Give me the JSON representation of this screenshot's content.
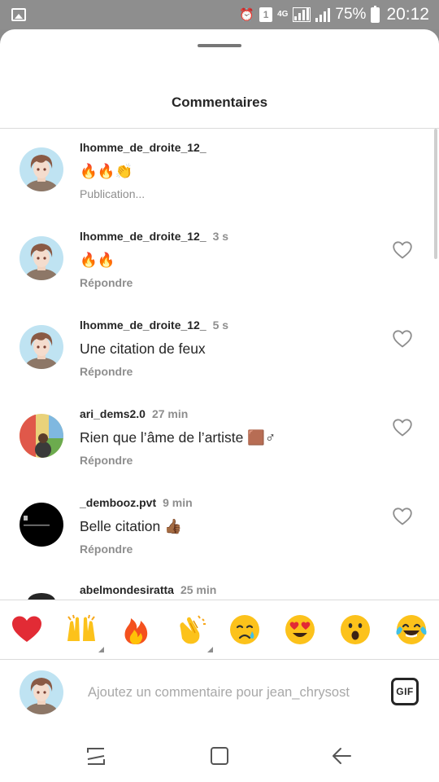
{
  "status_bar": {
    "left_icon": "gallery-icon",
    "network": "4G",
    "battery_percent": "75%",
    "time": "20:12",
    "sim_slot": "1",
    "icons": [
      "alarm-icon",
      "sim-icon",
      "4g-icon",
      "signal-icon",
      "battery-icon"
    ]
  },
  "sheet": {
    "title": "Commentaires"
  },
  "comments": [
    {
      "username": "lhomme_de_droite_12_",
      "time": "",
      "text": "🔥🔥👏",
      "action": "Publication...",
      "liked": false,
      "avatar": "anime-boy"
    },
    {
      "username": "lhomme_de_droite_12_",
      "time": "3 s",
      "text": "🔥🔥",
      "action": "Répondre",
      "liked": false,
      "avatar": "anime-boy"
    },
    {
      "username": "lhomme_de_droite_12_",
      "time": "5 s",
      "text": "Une citation de feux",
      "action": "Répondre",
      "liked": false,
      "avatar": "anime-boy"
    },
    {
      "username": "ari_dems2.0",
      "time": "27 min",
      "text": "Rien que l’âme de l’artiste 🟫♂",
      "action": "Répondre",
      "liked": false,
      "avatar": "street-art"
    },
    {
      "username": "_dembooz.pvt",
      "time": "9 min",
      "text": "Belle citation 👍🏾",
      "action": "Répondre",
      "liked": false,
      "avatar": "dark-circle"
    },
    {
      "username": "abelmondesiratta",
      "time": "25 min"
    }
  ],
  "emoji_bar": {
    "emojis": [
      "❤️",
      "🙌",
      "🔥",
      "👏",
      "😢",
      "😍",
      "😮",
      "😂"
    ],
    "icons": [
      "red-heart-icon",
      "raising-hands-icon",
      "fire-icon",
      "clapping-hands-icon",
      "crying-face-icon",
      "heart-eyes-icon",
      "surprised-face-icon",
      "tears-of-joy-icon"
    ]
  },
  "composer": {
    "placeholder": "Ajoutez un commentaire pour jean_chrysost",
    "gif_label": "GIF"
  },
  "nav_bar": {
    "buttons": [
      "recent-apps-icon",
      "home-icon",
      "back-icon"
    ]
  },
  "colors": {
    "text": "#262626",
    "secondary": "#8e8e8e",
    "divider": "#dbdbdb",
    "status_bg": "#8e8e8e"
  }
}
